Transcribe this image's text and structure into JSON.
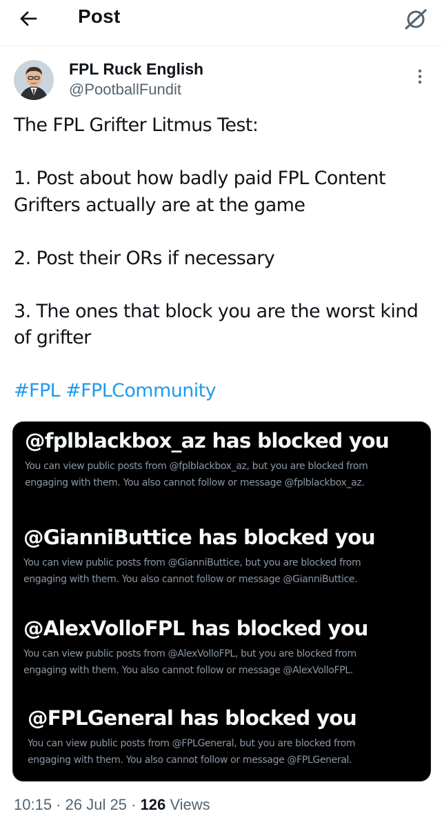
{
  "header": {
    "title": "Post"
  },
  "author": {
    "name": "FPL Ruck English",
    "handle": "@PootballFundit"
  },
  "post": {
    "lines": [
      "The FPL Grifter Litmus Test:",
      "1. Post about how badly paid FPL Content Grifters actually are at the game",
      "2. Post their ORs if necessary",
      "3. The ones that block you are the worst kind of grifter"
    ],
    "hashtags": [
      "#FPL",
      "#FPLCommunity"
    ]
  },
  "media": {
    "blocks": [
      {
        "heading": "@fplblackbox_az has blocked you",
        "line1": "You can view public posts from @fplblackbox_az, but you are blocked from",
        "line2": "engaging with them. You also cannot follow or message @fplblackbox_az."
      },
      {
        "heading": "@GianniButtice has blocked you",
        "line1": "You can view public posts from @GianniButtice, but you are blocked from",
        "line2": "engaging with them. You also cannot follow or message @GianniButtice."
      },
      {
        "heading": "@AlexVolloFPL has blocked you",
        "line1": "You can view public posts from @AlexVolloFPL, but you are blocked from",
        "line2": "engaging with them. You also cannot follow or message @AlexVolloFPL."
      },
      {
        "heading": "@FPLGeneral has blocked you",
        "line1": "You can view public posts from @FPLGeneral, but you are blocked from",
        "line2": "engaging with them. You also cannot follow or message @FPLGeneral."
      }
    ]
  },
  "meta": {
    "time": "10:15",
    "date": "26 Jul 25",
    "views_count": "126",
    "views_label": "Views"
  },
  "colors": {
    "accent": "#1d9bf0",
    "text": "#0f1419",
    "secondary": "#536471",
    "media_bg": "#000000"
  },
  "icons": [
    "back-arrow-icon",
    "grok-icon",
    "more-vertical-icon"
  ]
}
